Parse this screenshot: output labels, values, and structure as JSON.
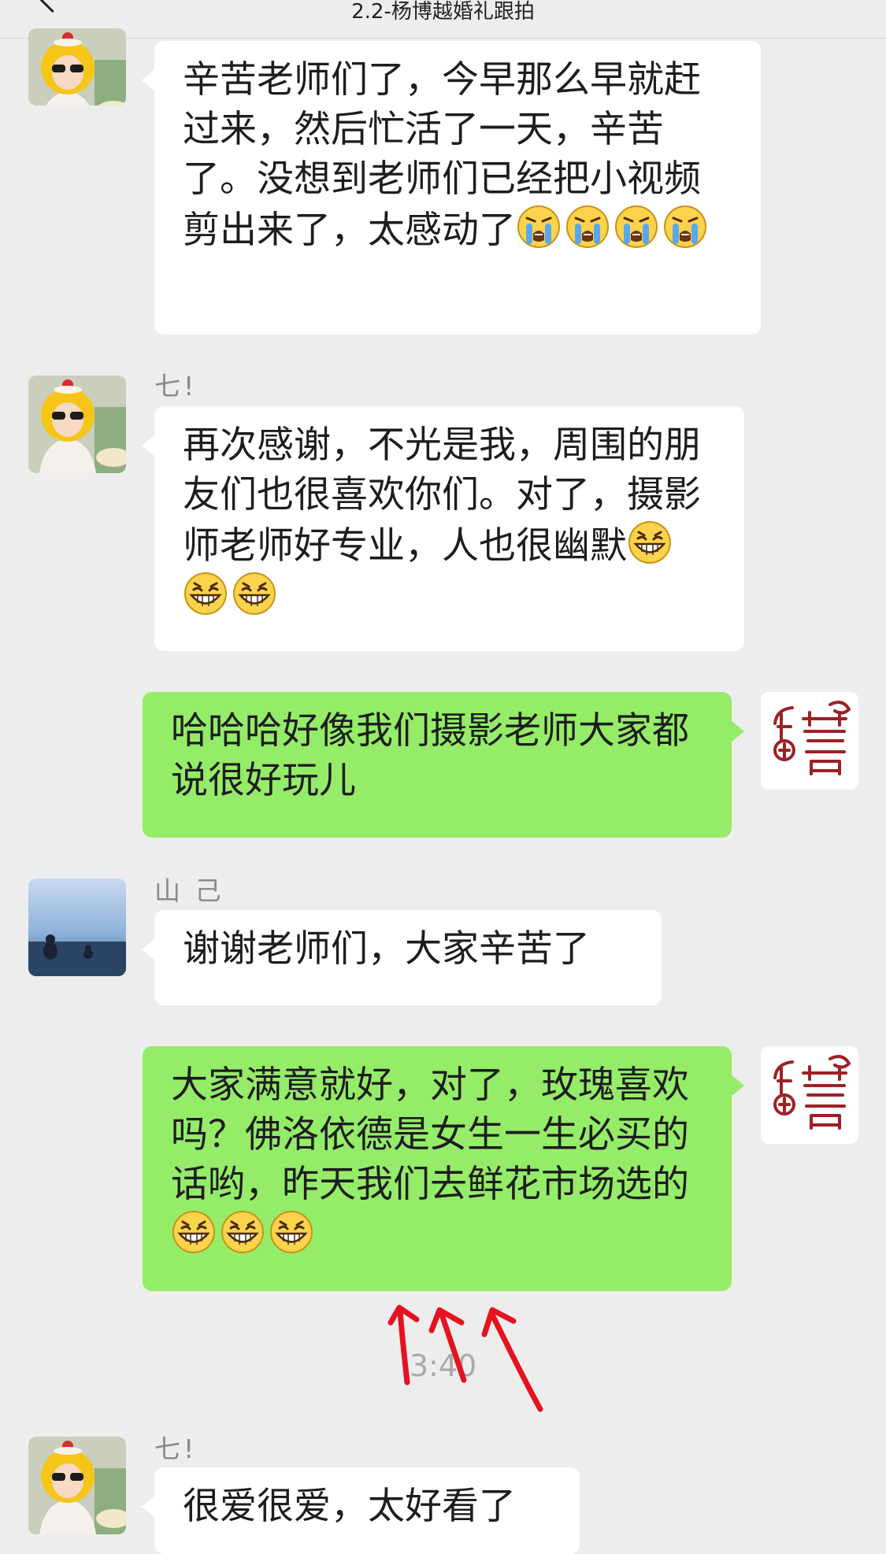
{
  "header": {
    "title": "2.2-杨博越婚礼跟拍"
  },
  "messages": [
    {
      "id": "m1",
      "side": "left",
      "avatar": "avatar-cartoon-girl",
      "sender": "",
      "text": "辛苦老师们了，今早那么早就赶过来，然后忙活了一天，辛苦了。没想到老师们已经把小视频剪出来了，太感动了",
      "emojis": [
        "crying-face-emoji",
        "crying-face-emoji",
        "crying-face-emoji",
        "crying-face-emoji"
      ]
    },
    {
      "id": "m2",
      "side": "left",
      "avatar": "avatar-cartoon-girl",
      "sender": "七!",
      "text": "再次感谢，不光是我，周围的朋友们也很喜欢你们。对了，摄影师老师好专业，人也很幽默",
      "emojis": [
        "grinning-face-emoji",
        "grinning-face-emoji",
        "grinning-face-emoji"
      ]
    },
    {
      "id": "m3",
      "side": "right",
      "avatar": "avatar-double-happiness",
      "sender": "",
      "text": "哈哈哈好像我们摄影老师大家都说很好玩儿",
      "emojis": []
    },
    {
      "id": "m4",
      "side": "left",
      "avatar": "avatar-seaside-photo",
      "sender": "山 己",
      "text": "谢谢老师们，大家辛苦了",
      "emojis": []
    },
    {
      "id": "m5",
      "side": "right",
      "avatar": "avatar-double-happiness",
      "sender": "",
      "text": "大家满意就好，对了，玫瑰喜欢吗？佛洛依德是女生一生必买的话哟，昨天我们去鲜花市场选的",
      "emojis": [
        "grinning-face-emoji",
        "grinning-face-emoji",
        "grinning-face-emoji"
      ]
    },
    {
      "id": "m6",
      "side": "left",
      "avatar": "avatar-cartoon-girl",
      "sender": "七!",
      "text": "很爱很爱，太好看了",
      "emojis": []
    }
  ],
  "timestamp": "3:40",
  "annotation": {
    "arrow_color": "#e5121f",
    "arrow_count": 3
  },
  "colors": {
    "background": "#ededed",
    "incoming_bubble": "#ffffff",
    "outgoing_bubble": "#95ec69"
  }
}
